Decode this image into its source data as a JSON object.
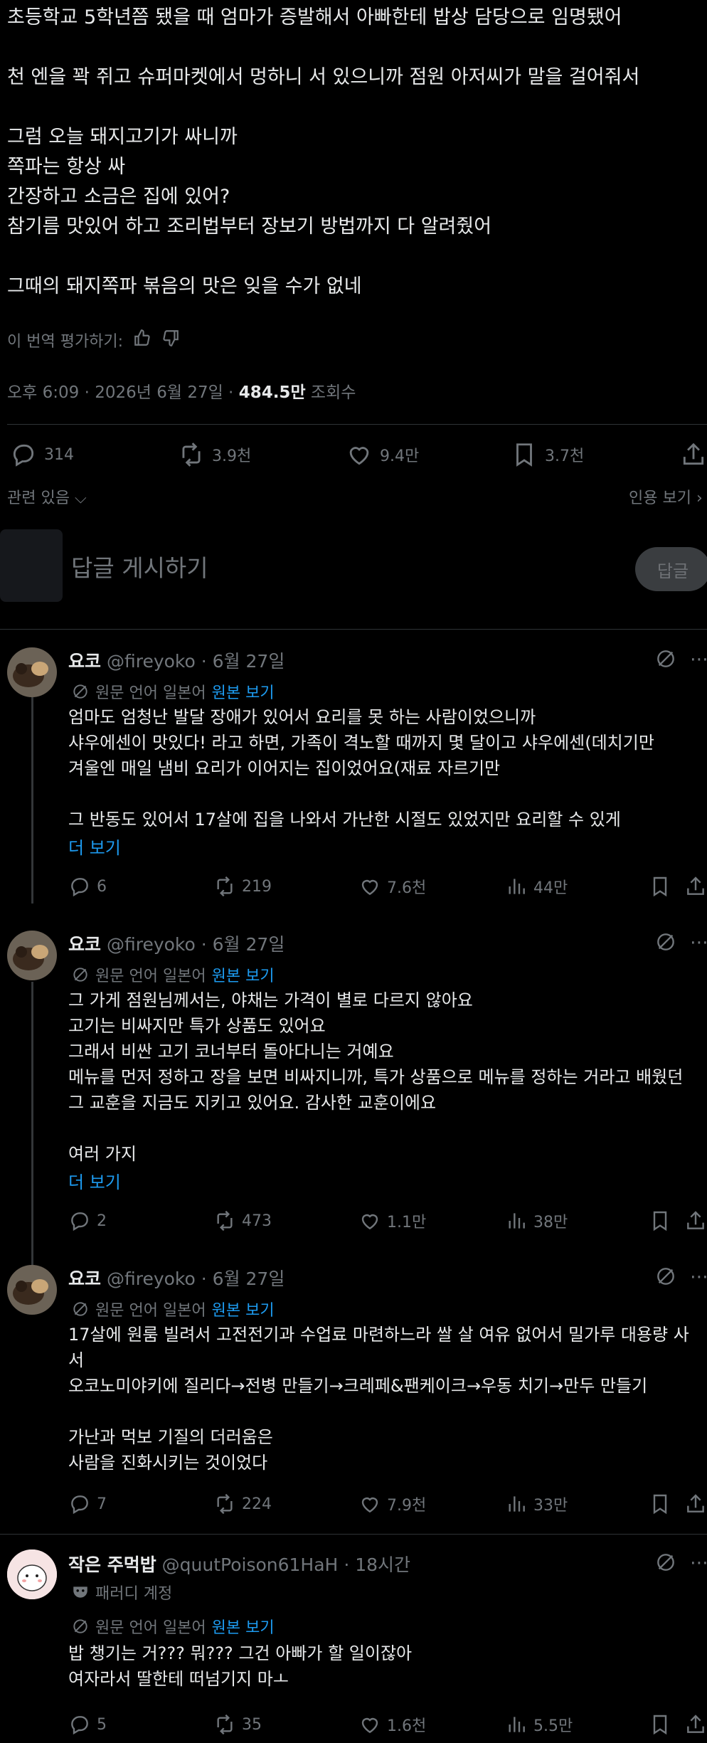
{
  "post": {
    "lines": [
      "초등학교 5학년쯤 됐을 때 엄마가 증발해서 아빠한테 밥상 담당으로 임명됐어",
      "",
      "천 엔을 꽉 쥐고 슈퍼마켓에서 멍하니 서 있으니까 점원 아저씨가 말을 걸어줘서",
      "",
      "그럼 오늘 돼지고기가 싸니까",
      "쪽파는 항상 싸",
      "간장하고 소금은 집에 있어?",
      "참기름 맛있어 하고 조리법부터 장보기 방법까지 다 알려줬어",
      "",
      "그때의 돼지쪽파 볶음의 맛은 잊을 수가 없네"
    ],
    "rate_translation": "이 번역 평가하기:",
    "meta_time": "오후 6:09 · 2026년 6월 27일 · ",
    "meta_views": "484.5만",
    "meta_views_label": " 조회수",
    "stats": {
      "replies": "314",
      "retweets": "3.9천",
      "likes": "9.4만",
      "bookmarks": "3.7천"
    },
    "related": "관련 있음",
    "quotes": "인용 보기"
  },
  "reply_box": {
    "placeholder": "답글 게시하기",
    "button": "답글"
  },
  "translated_label": "원문 언어 일본어",
  "show_original": "원본 보기",
  "show_more": "더 보기",
  "colors": {
    "link": "#1d9bf0",
    "muted": "#71767b",
    "text": "#e7e9ea"
  },
  "replies": [
    {
      "name": "요코",
      "handle": "@fireyoko",
      "time": "· 6월 27일",
      "lines": [
        "엄마도 엄청난 발달 장애가 있어서 요리를 못 하는 사람이었으니까",
        "샤우에센이 맛있다! 라고 하면, 가족이 격노할 때까지 몇 달이고 샤우에센(데치기만",
        "겨울엔 매일 냄비 요리가 이어지는 집이었어요(재료 자르기만",
        "",
        "그 반동도 있어서 17살에 집을 나와서 가난한 시절도 있었지만 요리할 수 있게"
      ],
      "more": true,
      "stats": {
        "replies": "6",
        "retweets": "219",
        "likes": "7.6천",
        "views": "44만"
      }
    },
    {
      "name": "요코",
      "handle": "@fireyoko",
      "time": "· 6월 27일",
      "lines": [
        "그 가게 점원님께서는, 야채는 가격이 별로 다르지 않아요",
        "고기는 비싸지만 특가 상품도 있어요",
        "그래서 비싼 고기 코너부터 돌아다니는 거예요",
        "메뉴를 먼저 정하고 장을 보면 비싸지니까, 특가 상품으로 메뉴를 정하는 거라고 배웠던",
        "그 교훈을 지금도 지키고 있어요. 감사한 교훈이에요",
        "",
        "여러 가지"
      ],
      "more": true,
      "stats": {
        "replies": "2",
        "retweets": "473",
        "likes": "1.1만",
        "views": "38만"
      }
    },
    {
      "name": "요코",
      "handle": "@fireyoko",
      "time": "· 6월 27일",
      "lines": [
        "17살에 원룸 빌려서 고전전기과 수업료 마련하느라 쌀 살 여유 없어서 밀가루 대용량 사",
        "서",
        "오코노미야키에 질리다→전병 만들기→크레페&팬케이크→우동 치기→만두 만들기",
        "",
        "가난과 먹보 기질의 더러움은",
        "사람을 진화시키는 것이었다"
      ],
      "more": false,
      "stats": {
        "replies": "7",
        "retweets": "224",
        "likes": "7.9천",
        "views": "33만"
      }
    },
    {
      "name": "작은 주먹밥",
      "handle": "@quutPoison61HaH",
      "time": "· 18시간",
      "parody": "패러디 계정",
      "lines": [
        "밥 챙기는 거??? 뭐??? 그건 아빠가 할 일이잖아",
        "여자라서 딸한테 떠넘기지 마ㅗ"
      ],
      "more": false,
      "stats": {
        "replies": "5",
        "retweets": "35",
        "likes": "1.6천",
        "views": "5.5만"
      }
    }
  ]
}
